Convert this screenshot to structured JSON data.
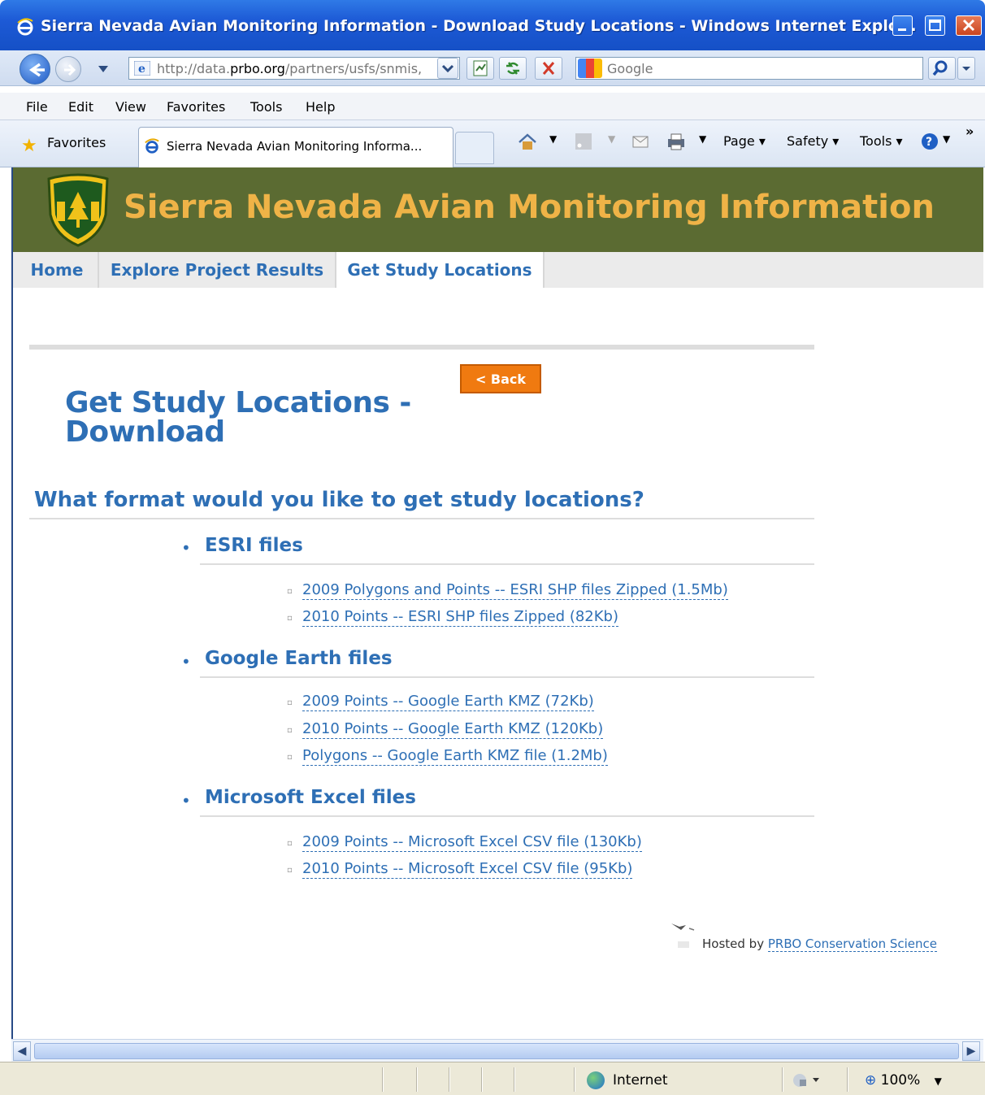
{
  "window": {
    "title": "Sierra Nevada Avian Monitoring Information - Download Study Locations - Windows Internet Explo..."
  },
  "navbar": {
    "url_prefix": "http://data.",
    "url_domain": "prbo.org",
    "url_suffix": "/partners/usfs/snmis,",
    "search_placeholder": "Google"
  },
  "menu": {
    "items": [
      "File",
      "Edit",
      "View",
      "Favorites",
      "Tools",
      "Help"
    ]
  },
  "favbar": {
    "favorites_label": "Favorites",
    "tab_title": "Sierra Nevada Avian Monitoring Informa...",
    "page_label": "Page",
    "safety_label": "Safety",
    "tools_label": "Tools"
  },
  "site": {
    "title": "Sierra Nevada Avian Monitoring Information",
    "nav": [
      "Home",
      "Explore Project Results",
      "Get Study Locations"
    ],
    "back_button": "< Back",
    "page_title": "Get Study Locations - Download",
    "question": "What format would you like to get study locations?",
    "sections": [
      {
        "heading": "ESRI files",
        "links": [
          "2009 Polygons and Points -- ESRI SHP files Zipped (1.5Mb)",
          "2010 Points -- ESRI SHP files Zipped (82Kb)"
        ]
      },
      {
        "heading": "Google Earth files",
        "links": [
          "2009 Points -- Google Earth KMZ (72Kb)",
          "2010 Points -- Google Earth KMZ (120Kb)",
          "Polygons -- Google Earth KMZ file (1.2Mb)"
        ]
      },
      {
        "heading": "Microsoft Excel files",
        "links": [
          "2009 Points -- Microsoft Excel CSV file (130Kb)",
          "2010 Points -- Microsoft Excel CSV file (95Kb)"
        ]
      }
    ],
    "hosted_prefix": "Hosted by",
    "hosted_link": "PRBO Conservation Science"
  },
  "status": {
    "zone": "Internet",
    "zoom": "100%"
  },
  "colors": {
    "header_bg": "#5b6b32",
    "header_title": "#efb347",
    "link_blue": "#2e6fb5",
    "back_button": "#f07a10"
  }
}
